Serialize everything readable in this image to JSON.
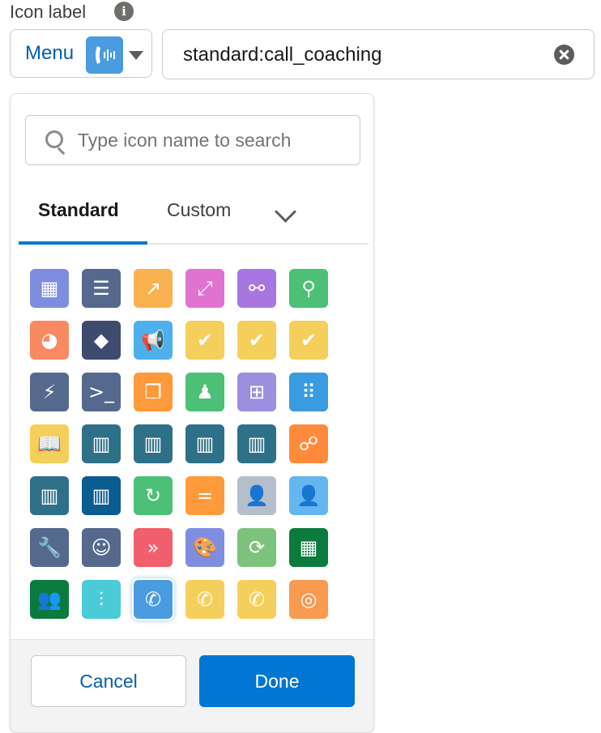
{
  "field": {
    "label": "Icon label",
    "info_icon": "info-icon",
    "menu_label": "Menu",
    "menu_icon": "call-coaching-icon",
    "value": "standard:call_coaching"
  },
  "picker": {
    "search_placeholder": "Type icon name to search",
    "tabs": [
      "Standard",
      "Custom"
    ],
    "active_tab": "Standard",
    "cancel_label": "Cancel",
    "done_label": "Done",
    "selected_icon": "call-coaching-icon",
    "icons": [
      [
        {
          "name": "buildings-icon",
          "color": "#7f8de1",
          "glyph": "▦"
        },
        {
          "name": "list-icon",
          "color": "#54698d",
          "glyph": "☰"
        },
        {
          "name": "signal-arrow-icon",
          "color": "#f9b24f",
          "glyph": "↗"
        },
        {
          "name": "expand-arrow-icon",
          "color": "#e073cf",
          "glyph": "⤢"
        },
        {
          "name": "flow-icon",
          "color": "#a876e0",
          "glyph": "⚯"
        },
        {
          "name": "location-pin-icon",
          "color": "#4bc076",
          "glyph": "⚲"
        }
      ],
      [
        {
          "name": "chat-chart-icon",
          "color": "#f88962",
          "glyph": "◕"
        },
        {
          "name": "shapes-icon",
          "color": "#3c4b6e",
          "glyph": "◆"
        },
        {
          "name": "megaphone-icon",
          "color": "#4cb0ea",
          "glyph": "📢"
        },
        {
          "name": "approval-chat-icon",
          "color": "#f5cf5b",
          "glyph": "✔"
        },
        {
          "name": "approval-chat-icon",
          "color": "#f5cf5b",
          "glyph": "✔"
        },
        {
          "name": "approval-chat-icon",
          "color": "#f5cf5b",
          "glyph": "✔"
        }
      ],
      [
        {
          "name": "plug-icon",
          "color": "#54698d",
          "glyph": "⚡"
        },
        {
          "name": "terminal-icon",
          "color": "#54698d",
          "glyph": ">_"
        },
        {
          "name": "copy-icon",
          "color": "#ff9a3c",
          "glyph": "❐"
        },
        {
          "name": "stamp-icon",
          "color": "#4bc076",
          "glyph": "♟"
        },
        {
          "name": "grid-box-icon",
          "color": "#9c8fe0",
          "glyph": "⊞"
        },
        {
          "name": "apps-grid-icon",
          "color": "#3a9be0",
          "glyph": "⠿"
        }
      ],
      [
        {
          "name": "open-book-icon",
          "color": "#f5cf5b",
          "glyph": "📖"
        },
        {
          "name": "barcode-arrow-icon",
          "color": "#2e7088",
          "glyph": "▥"
        },
        {
          "name": "barcode-edit-icon",
          "color": "#2e7088",
          "glyph": "▥"
        },
        {
          "name": "barcode-clock-icon",
          "color": "#2e7088",
          "glyph": "▥"
        },
        {
          "name": "barcode-icon",
          "color": "#2e7088",
          "glyph": "▥"
        },
        {
          "name": "network-icon",
          "color": "#ff8a3c",
          "glyph": "☍"
        }
      ],
      [
        {
          "name": "barcode-clock-icon",
          "color": "#2e7088",
          "glyph": "▥"
        },
        {
          "name": "barcode-check-icon",
          "color": "#0b5c8f",
          "glyph": "▥"
        },
        {
          "name": "refresh-share-icon",
          "color": "#4bc076",
          "glyph": "↻"
        },
        {
          "name": "equals-icon",
          "color": "#ff9a3c",
          "glyph": "="
        },
        {
          "name": "contact-icon",
          "color": "#b5bfcc",
          "glyph": "👤"
        },
        {
          "name": "user-icon",
          "color": "#65b6f0",
          "glyph": "👤"
        }
      ],
      [
        {
          "name": "wrench-icon",
          "color": "#54698d",
          "glyph": "🔧"
        },
        {
          "name": "robot-icon",
          "color": "#54698d",
          "glyph": "☺"
        },
        {
          "name": "merge-arrow-icon",
          "color": "#f05f6b",
          "glyph": "»"
        },
        {
          "name": "palette-icon",
          "color": "#7f8de1",
          "glyph": "🎨"
        },
        {
          "name": "clock-refresh-icon",
          "color": "#7dc37d",
          "glyph": "⟳"
        },
        {
          "name": "store-cart-icon",
          "color": "#0b7a3d",
          "glyph": "▦"
        }
      ],
      [
        {
          "name": "team-icon",
          "color": "#0b7a3d",
          "glyph": "👥"
        },
        {
          "name": "sliders-icon",
          "color": "#4bcad8",
          "glyph": "⫶"
        },
        {
          "name": "call-coaching-icon",
          "color": "#4a9be0",
          "glyph": "✆"
        },
        {
          "name": "phone-history-icon",
          "color": "#f5cf5b",
          "glyph": "✆"
        },
        {
          "name": "phone-icon",
          "color": "#f5cf5b",
          "glyph": "✆"
        },
        {
          "name": "target-icon",
          "color": "#f89a4f",
          "glyph": "◎"
        }
      ]
    ]
  }
}
